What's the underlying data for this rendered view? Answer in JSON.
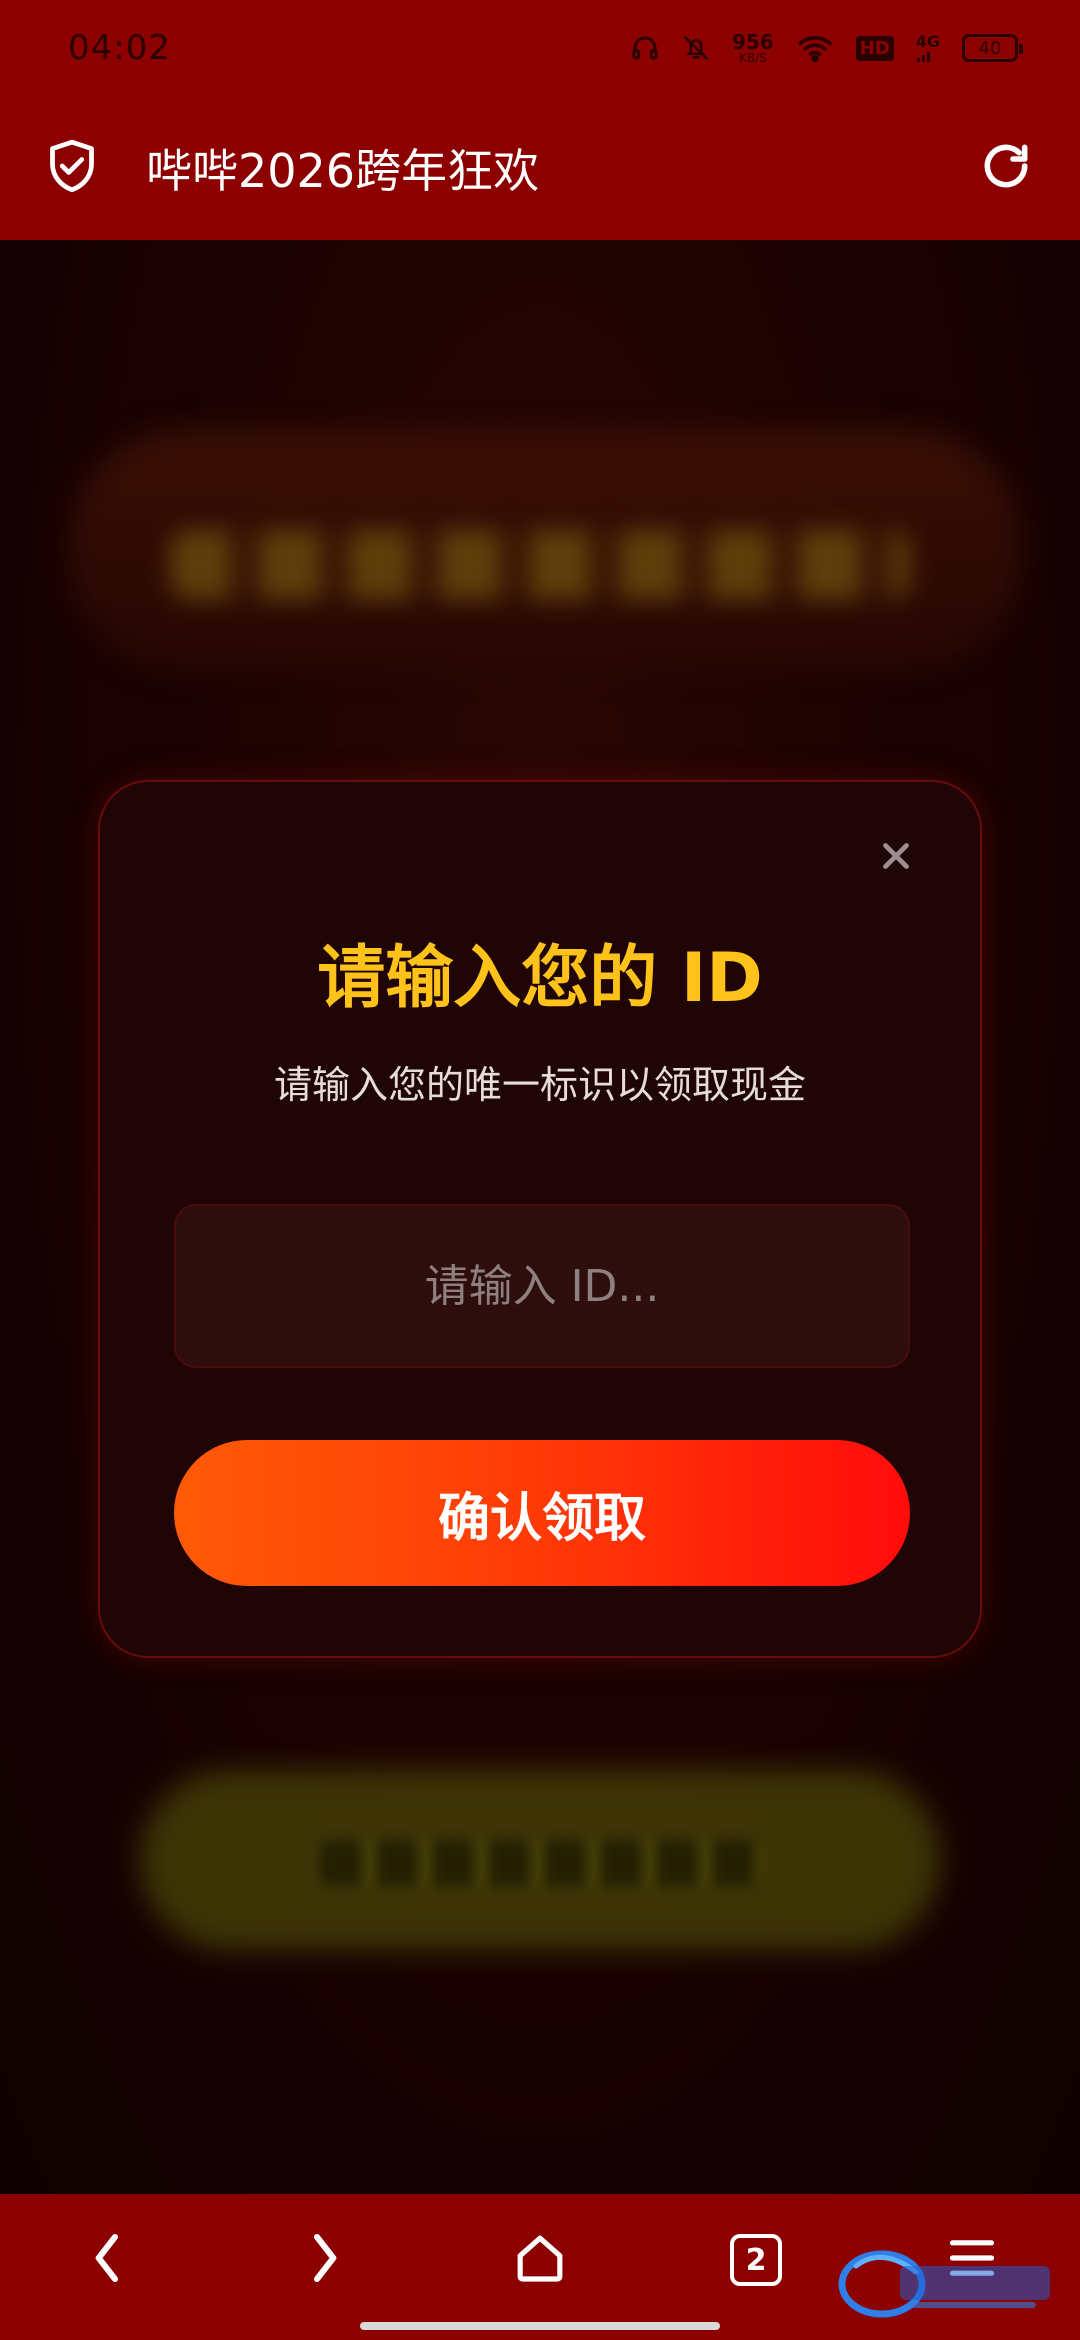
{
  "status_bar": {
    "time": "04:02",
    "net_speed_value": "956",
    "net_speed_unit": "KB/S",
    "hd_label": "HD",
    "net_type": "4G",
    "battery": "40"
  },
  "app_bar": {
    "title": "哔哔2026跨年狂欢"
  },
  "modal": {
    "title": "请输入您的 ID",
    "subtitle": "请输入您的唯一标识以领取现金",
    "input_placeholder": "请输入 ID...",
    "input_value": "",
    "confirm_label": "确认领取"
  },
  "bottom_nav": {
    "tab_count": "2"
  },
  "colors": {
    "bar_red": "#8c0000",
    "title_gold": "#ffc21a",
    "button_start": "#ff5a07",
    "button_end": "#ff0b0b"
  },
  "icons": {
    "shield": "shield-check-icon",
    "reload": "refresh-icon",
    "close": "close-icon",
    "back": "back-icon",
    "forward": "forward-icon",
    "home": "home-icon",
    "menu": "menu-icon"
  }
}
